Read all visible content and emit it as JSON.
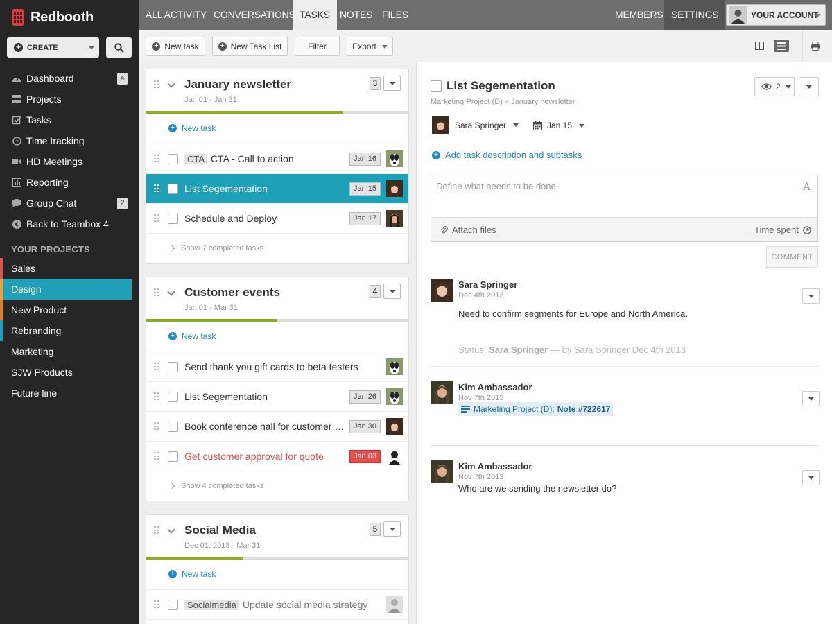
{
  "brand": {
    "name": "Redbooth",
    "logo_color": "#e03b3b"
  },
  "sidebar": {
    "create_label": "CREATE",
    "nav": [
      {
        "icon": "dashboard-icon",
        "label": "Dashboard",
        "badge": "4"
      },
      {
        "icon": "projects-icon",
        "label": "Projects",
        "badge": ""
      },
      {
        "icon": "tasks-icon",
        "label": "Tasks",
        "badge": ""
      },
      {
        "icon": "clock-icon",
        "label": "Time tracking",
        "badge": ""
      },
      {
        "icon": "video-icon",
        "label": "HD Meetings",
        "badge": ""
      },
      {
        "icon": "reporting-icon",
        "label": "Reporting",
        "badge": ""
      },
      {
        "icon": "chat-icon",
        "label": "Group Chat",
        "badge": "2"
      },
      {
        "icon": "back-arrow-icon",
        "label": "Back to Teambox 4",
        "badge": ""
      }
    ],
    "projects_title": "YOUR PROJECTS",
    "projects": [
      {
        "label": "Sales",
        "color": "#d9534f"
      },
      {
        "label": "Design",
        "color": "#e8a33a"
      },
      {
        "label": "New Product",
        "color": "#d9802f"
      },
      {
        "label": "Rebranding",
        "color": "#1ea0b8"
      },
      {
        "label": "Marketing",
        "color": ""
      },
      {
        "label": "SJW Products",
        "color": ""
      },
      {
        "label": "Future line",
        "color": ""
      }
    ],
    "active_project": "Design"
  },
  "topnav": {
    "tabs": [
      "ALL ACTIVITY",
      "CONVERSATIONS",
      "TASKS",
      "NOTES",
      "FILES"
    ],
    "active_tab": "TASKS",
    "members": "MEMBERS",
    "settings": "SETTINGS",
    "account": "YOUR ACCOUNT"
  },
  "toolbar": {
    "new_task": "New task",
    "new_task_list": "New Task List",
    "filter": "Filter",
    "export": "Export"
  },
  "task_lists": [
    {
      "title": "January newsletter",
      "dates": "Jan 01 - Jan 31",
      "count": "3",
      "progress": 0.75,
      "new_task": "New task",
      "tasks": [
        {
          "tag": "CTA",
          "label": "CTA - Call to action",
          "due": "Jan 16",
          "avatar": "dog",
          "state": "normal"
        },
        {
          "tag": "",
          "label": "List Segementation",
          "due": "Jan 15",
          "avatar": "woman1",
          "state": "selected"
        },
        {
          "tag": "",
          "label": "Schedule and Deploy",
          "due": "Jan 17",
          "avatar": "woman2",
          "state": "normal"
        }
      ],
      "show_completed": "Show 7 completed tasks"
    },
    {
      "title": "Customer events",
      "dates": "Jan 01 - Mar 31",
      "count": "4",
      "progress": 0.5,
      "new_task": "New task",
      "tasks": [
        {
          "tag": "",
          "label": "Send thank you gift cards to beta testers",
          "due": "",
          "avatar": "dog",
          "state": "normal"
        },
        {
          "tag": "",
          "label": "List Segementation",
          "due": "Jan 26",
          "avatar": "dog",
          "state": "normal"
        },
        {
          "tag": "",
          "label": "Book conference hall for customer …",
          "due": "Jan 30",
          "avatar": "woman1",
          "state": "normal"
        },
        {
          "tag": "",
          "label": "Get customer approval for quote",
          "due": "Jan 03",
          "avatar": "woman3",
          "state": "overdue"
        }
      ],
      "show_completed": "Show 4 completed tasks"
    },
    {
      "title": "Social Media",
      "dates": "Dec 01, 2013 - Mar 31",
      "count": "5",
      "progress": 0.37,
      "new_task": "New task",
      "tasks": [
        {
          "tag": "Socialmedia",
          "label": "Update social media strategy",
          "due": "",
          "avatar": "man",
          "state": "normal"
        }
      ]
    }
  ],
  "detail": {
    "title": "List Segementation",
    "breadcrumb_project": "Marketing Project (D)",
    "breadcrumb_sep": "»",
    "breadcrumb_list": "January newsletter",
    "watchers": "2",
    "assignee": "Sara Springer",
    "due": "Jan 15",
    "add_description": "Add task description and subtasks",
    "placeholder": "Define what needs to be done",
    "attach": "Attach files",
    "time_spent": "Time spent",
    "comment_btn": "COMMENT",
    "activity": [
      {
        "name": "Sara Springer",
        "date": "Dec 4th 2013",
        "body": "Need to confirm segments for Europe and North America.",
        "status_prefix": "Status:",
        "status_name": "Sara Springer",
        "status_suffix": "— by Sara Springer Dec 4th 2013"
      },
      {
        "name": "Kim Ambassador",
        "date": "Nov 7th 2013",
        "note_project": "Marketing Project (D):",
        "note_ref": "Note #722617"
      },
      {
        "name": "Kim Ambassador",
        "date": "Nov 7th 2013",
        "body": "Who are we sending the newsletter do?"
      }
    ]
  }
}
